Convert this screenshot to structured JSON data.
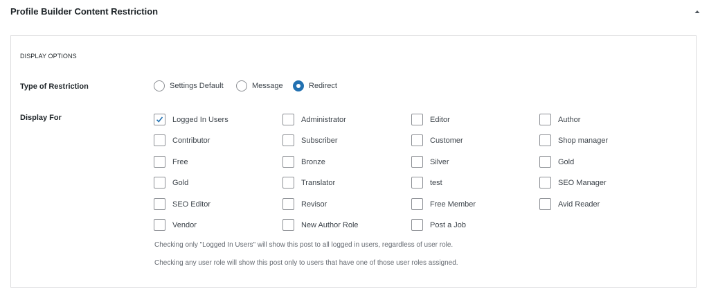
{
  "metabox": {
    "title": "Profile Builder Content Restriction",
    "toggle_icon": "triangle-up-icon"
  },
  "section_title": "DISPLAY OPTIONS",
  "restriction": {
    "label": "Type of Restriction",
    "options": [
      {
        "label": "Settings Default",
        "checked": false
      },
      {
        "label": "Message",
        "checked": false
      },
      {
        "label": "Redirect",
        "checked": true
      }
    ]
  },
  "display_for": {
    "label": "Display For",
    "roles": [
      {
        "label": "Logged In Users",
        "checked": true
      },
      {
        "label": "Administrator",
        "checked": false
      },
      {
        "label": "Editor",
        "checked": false
      },
      {
        "label": "Author",
        "checked": false
      },
      {
        "label": "Contributor",
        "checked": false
      },
      {
        "label": "Subscriber",
        "checked": false
      },
      {
        "label": "Customer",
        "checked": false
      },
      {
        "label": "Shop manager",
        "checked": false
      },
      {
        "label": "Free",
        "checked": false
      },
      {
        "label": "Bronze",
        "checked": false
      },
      {
        "label": "Silver",
        "checked": false
      },
      {
        "label": "Gold",
        "checked": false
      },
      {
        "label": "Gold",
        "checked": false
      },
      {
        "label": "Translator",
        "checked": false
      },
      {
        "label": "test",
        "checked": false
      },
      {
        "label": "SEO Manager",
        "checked": false
      },
      {
        "label": "SEO Editor",
        "checked": false
      },
      {
        "label": "Revisor",
        "checked": false
      },
      {
        "label": "Free Member",
        "checked": false
      },
      {
        "label": "Avid Reader",
        "checked": false
      },
      {
        "label": "Vendor",
        "checked": false
      },
      {
        "label": "New Author Role",
        "checked": false
      },
      {
        "label": "Post a Job",
        "checked": false
      }
    ],
    "help_1": "Checking only \"Logged In Users\" will show this post to all logged in users, regardless of user role.",
    "help_2": "Checking any user role will show this post only to users that have one of those user roles assigned."
  },
  "colors": {
    "accent": "#2271b1",
    "border": "#8c8f94",
    "help_text": "#646970"
  }
}
